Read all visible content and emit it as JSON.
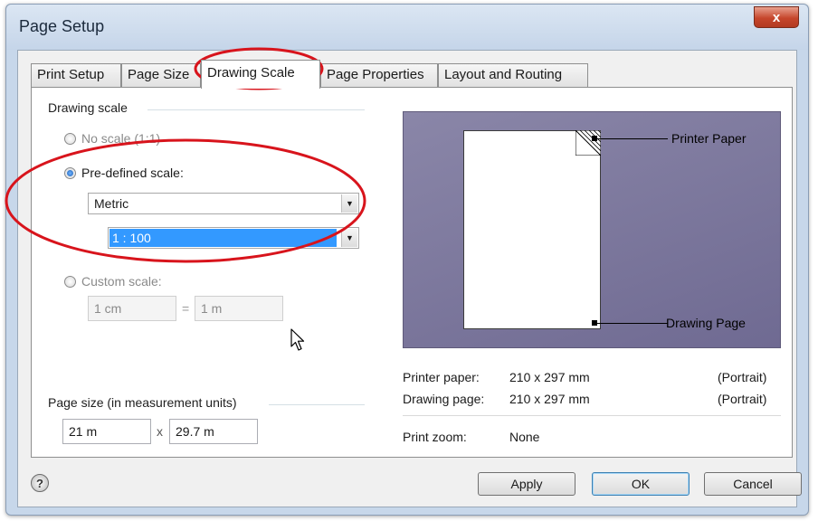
{
  "window": {
    "title": "Page Setup",
    "close_glyph": "x"
  },
  "tabs": [
    {
      "label": "Print Setup"
    },
    {
      "label": "Page Size"
    },
    {
      "label": "Drawing Scale"
    },
    {
      "label": "Page Properties"
    },
    {
      "label": "Layout and Routing"
    }
  ],
  "active_tab": "Drawing Scale",
  "drawing_scale": {
    "group_label": "Drawing scale",
    "no_scale_label": "No scale (1:1)",
    "predefined_label": "Pre-defined scale:",
    "predefined_selected": true,
    "system_value": "Metric",
    "scale_value": "1 : 100",
    "custom_label": "Custom scale:",
    "custom_left": "1 cm",
    "custom_equals": "=",
    "custom_right": "1 m"
  },
  "page_size": {
    "group_label": "Page size (in measurement units)",
    "width": "21 m",
    "times": "x",
    "height": "29.7 m"
  },
  "preview": {
    "printer_paper_callout": "Printer Paper",
    "drawing_page_callout": "Drawing Page"
  },
  "info": {
    "printer_paper_label": "Printer paper:",
    "printer_paper_value": "210 x 297 mm",
    "printer_paper_orientation": "(Portrait)",
    "drawing_page_label": "Drawing page:",
    "drawing_page_value": "210 x 297 mm",
    "drawing_page_orientation": "(Portrait)",
    "print_zoom_label": "Print zoom:",
    "print_zoom_value": "None"
  },
  "buttons": {
    "apply": "Apply",
    "ok": "OK",
    "cancel": "Cancel",
    "help": "?"
  },
  "icons": [
    "close-icon",
    "help-icon",
    "dropdown-arrow-icon",
    "radio-icon",
    "mouse-cursor-icon"
  ],
  "colors": {
    "preview_background": "#7d7a9e",
    "annotation_red": "#d8141c",
    "selection_blue": "#3399ff",
    "close_button_red": "#c6462c"
  }
}
